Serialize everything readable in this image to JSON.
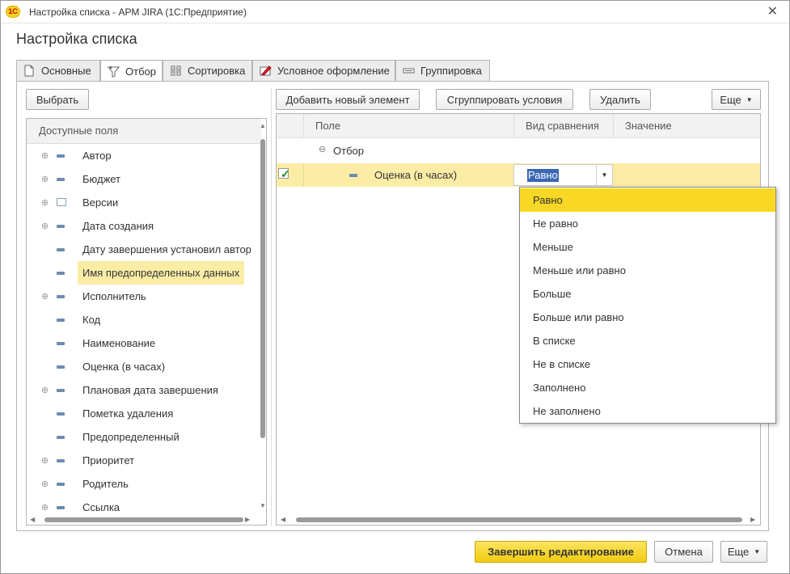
{
  "window": {
    "title": "Настройка списка - АРМ JIRA  (1С:Предприятие)",
    "logo": "1С",
    "close_glyph": "✕"
  },
  "form_title": "Настройка списка",
  "tabs": [
    {
      "label": "Основные",
      "icon": "document-icon"
    },
    {
      "label": "Отбор",
      "icon": "filter-icon",
      "active": true
    },
    {
      "label": "Сортировка",
      "icon": "sort-icon"
    },
    {
      "label": "Условное оформление",
      "icon": "pencil-icon"
    },
    {
      "label": "Группировка",
      "icon": "grouping-icon"
    }
  ],
  "left": {
    "select_button": "Выбрать",
    "header": "Доступные поля",
    "fields": [
      {
        "label": "Автор",
        "expandable": true,
        "icon": "field"
      },
      {
        "label": "Бюджет",
        "expandable": true,
        "icon": "field"
      },
      {
        "label": "Версии",
        "expandable": true,
        "icon": "table"
      },
      {
        "label": "Дата создания",
        "expandable": true,
        "icon": "field"
      },
      {
        "label": "Дату завершения установил автор",
        "expandable": false,
        "icon": "field"
      },
      {
        "label": "Имя предопределенных данных",
        "expandable": false,
        "icon": "field",
        "selected": true
      },
      {
        "label": "Исполнитель",
        "expandable": true,
        "icon": "field"
      },
      {
        "label": "Код",
        "expandable": false,
        "icon": "field"
      },
      {
        "label": "Наименование",
        "expandable": false,
        "icon": "field"
      },
      {
        "label": "Оценка (в часах)",
        "expandable": false,
        "icon": "field"
      },
      {
        "label": "Плановая дата завершения",
        "expandable": true,
        "icon": "field"
      },
      {
        "label": "Пометка удаления",
        "expandable": false,
        "icon": "field"
      },
      {
        "label": "Предопределенный",
        "expandable": false,
        "icon": "field"
      },
      {
        "label": "Приоритет",
        "expandable": true,
        "icon": "field"
      },
      {
        "label": "Родитель",
        "expandable": true,
        "icon": "field"
      },
      {
        "label": "Ссылка",
        "expandable": true,
        "icon": "field"
      }
    ]
  },
  "right": {
    "add_button": "Добавить новый элемент",
    "group_button": "Сгруппировать условия",
    "delete_button": "Удалить",
    "more_button": "Еще",
    "columns": [
      "Поле",
      "Вид сравнения",
      "Значение"
    ],
    "group_label": "Отбор",
    "condition": {
      "field": "Оценка (в часах)",
      "comparison": "Равно",
      "value": "",
      "checked": true
    }
  },
  "comparison_options": [
    "Равно",
    "Не равно",
    "Меньше",
    "Меньше или равно",
    "Больше",
    "Больше или равно",
    "В списке",
    "Не в списке",
    "Заполнено",
    "Не заполнено"
  ],
  "footer": {
    "finish_button": "Завершить редактирование",
    "cancel_button": "Отмена",
    "more_button": "Еще"
  },
  "colors": {
    "accent_yellow": "#f8d824",
    "selection_light": "#fbeca6",
    "text_selection": "#3a67b5"
  }
}
